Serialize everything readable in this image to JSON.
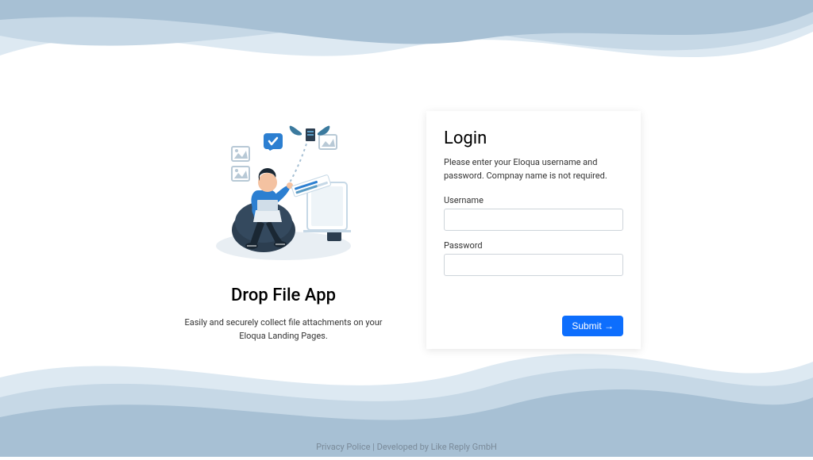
{
  "colors": {
    "wave_light": "#dde9f2",
    "wave_mid": "#c6d8e6",
    "wave_dark": "#a7c0d4",
    "primary": "#0d6efd"
  },
  "left": {
    "title": "Drop File App",
    "description": "Easily and securely collect file attachments on your Eloqua Landing Pages."
  },
  "login": {
    "title": "Login",
    "description": "Please enter your Eloqua username and password. Compnay name is not required.",
    "username_label": "Username",
    "username_value": "",
    "password_label": "Password",
    "password_value": "",
    "submit_label": "Submit →"
  },
  "footer": {
    "privacy": "Privacy Police",
    "separator": " | ",
    "developed": "Developed by Like Reply GmbH"
  }
}
